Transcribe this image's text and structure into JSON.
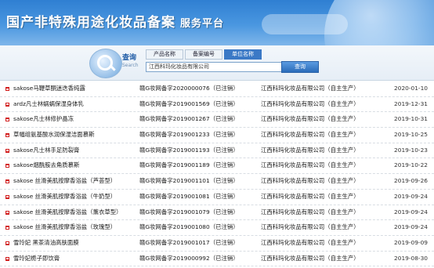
{
  "banner": {
    "title": "国产非特殊用途化妆品备案",
    "subtitle": "服务平台"
  },
  "search": {
    "label": "查询",
    "label_en": "Search",
    "tabs": [
      "产品名称",
      "备案编号",
      "单位名称"
    ],
    "active_tab": 2,
    "input_value": "江西科玛化妆品有限公司",
    "button_label": "查询"
  },
  "colors": {
    "banner": "#2f7fd2",
    "bullet": "#d21f1f",
    "tab_active": "#3b79c6"
  },
  "results": [
    {
      "name": "sakose马鞭草酮迷迭香纯露",
      "reg": "赣G妆网备字2020000076（已注销）",
      "company": "江西科玛化妆品有限公司（自主生产）",
      "date": "2020-01-10"
    },
    {
      "name": "ardz凡士林蜗蜗保湿身体乳",
      "reg": "赣G妆网备字2019001569（已注销）",
      "company": "江西科玛化妆品有限公司（自主生产）",
      "date": "2019-12-31"
    },
    {
      "name": "sakose凡士林修护晶冻",
      "reg": "赣G妆网备字2019001267（已注销）",
      "company": "江西科玛化妆品有限公司（自主生产）",
      "date": "2019-10-31"
    },
    {
      "name": "草幅组氨基酸水润保湿洁面慕斯",
      "reg": "赣G妆网备字2019001233（已注销）",
      "company": "江西科玛化妆品有限公司（自主生产）",
      "date": "2019-10-25"
    },
    {
      "name": "sakose凡士林手足防裂膏",
      "reg": "赣G妆网备字2019001193（已注销）",
      "company": "江西科玛化妆品有限公司（自主生产）",
      "date": "2019-10-23"
    },
    {
      "name": "sakose烟酰胺去角质慕斯",
      "reg": "赣G妆网备字2019001189（已注销）",
      "company": "江西科玛化妆品有限公司（自主生产）",
      "date": "2019-10-22"
    },
    {
      "name": "sakose 丝滑美肌按摩香浴盐（芦荟型）",
      "reg": "赣G妆网备字2019001101（已注销）",
      "company": "江西科玛化妆品有限公司（自主生产）",
      "date": "2019-09-26"
    },
    {
      "name": "sakose 丝滑美肌按摩香浴盐（牛奶型）",
      "reg": "赣G妆网备字2019001081（已注销）",
      "company": "江西科玛化妆品有限公司（自主生产）",
      "date": "2019-09-24"
    },
    {
      "name": "sakose 丝滑美肌按摩香浴盐（薰衣草型）",
      "reg": "赣G妆网备字2019001079（已注销）",
      "company": "江西科玛化妆品有限公司（自主生产）",
      "date": "2019-09-24"
    },
    {
      "name": "sakose 丝滑美肌按摩香浴盐（玫瑰型）",
      "reg": "赣G妆网备字2019001080（已注销）",
      "company": "江西科玛化妆品有限公司（自主生产）",
      "date": "2019-09-24"
    },
    {
      "name": "雪玲妃 黑茶清油高肤面膜",
      "reg": "赣G妆网备字2019001017（已注销）",
      "company": "江西科玛化妆品有限公司（自主生产）",
      "date": "2019-09-09"
    },
    {
      "name": "雪玲妃栀子即饮膏",
      "reg": "赣G妆网备字2019000992（已注销）",
      "company": "江西科玛化妆品有限公司（自主生产）",
      "date": "2019-08-30"
    }
  ]
}
